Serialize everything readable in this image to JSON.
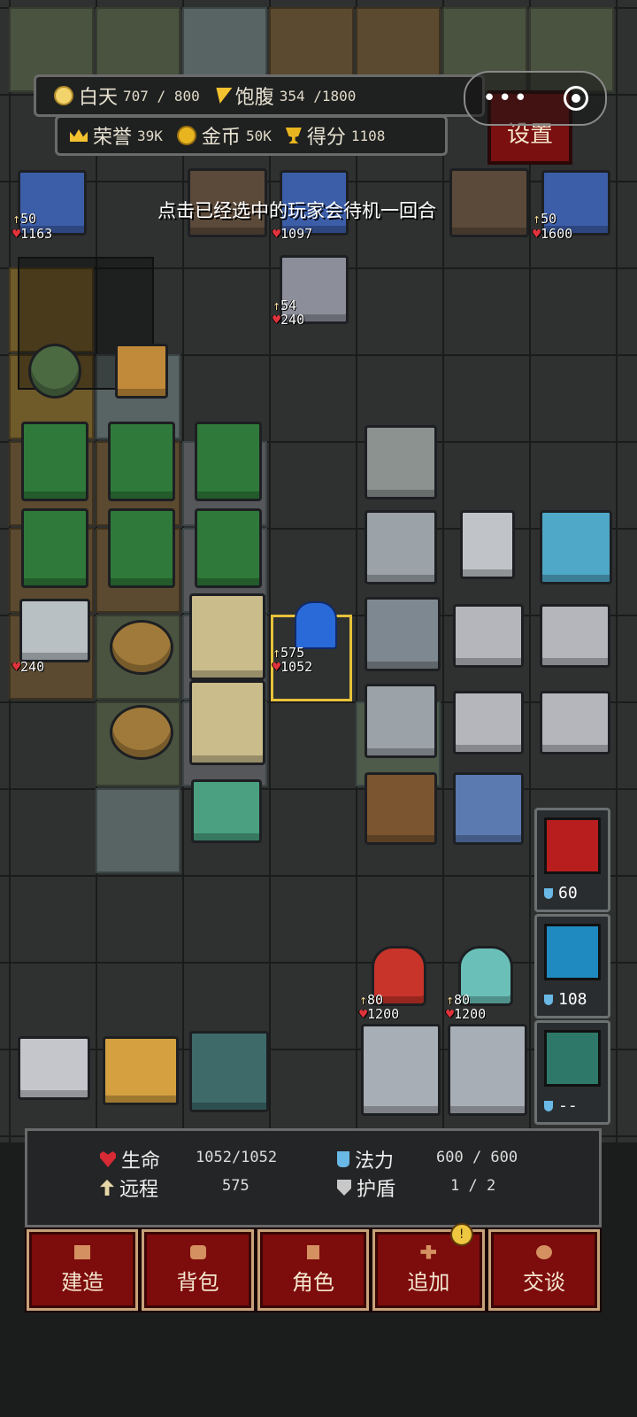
{
  "hud": {
    "day_label": "白天",
    "day_value": "707 / 800",
    "food_label": "饱腹",
    "food_value": "354 /1800",
    "honor_label": "荣誉",
    "honor_value": "39K",
    "gold_label": "金币",
    "gold_value": "50K",
    "score_label": "得分",
    "score_value": "1108"
  },
  "capsule": {
    "more": "•••"
  },
  "settings_label": "设置",
  "tip": "点击已经选中的玩家会待机一回合",
  "units": {
    "tower_1": {
      "atk": "50",
      "hp": "1163"
    },
    "tower_2": {
      "hp": "1097"
    },
    "tower_3": {
      "atk": "50",
      "hp": "1600"
    },
    "knight": {
      "atk": "54",
      "hp": "240"
    },
    "workshop": {
      "hp": "240"
    },
    "player": {
      "atk": "575",
      "hp": "1052"
    },
    "girl_red": {
      "atk": "80",
      "hp": "1200"
    },
    "girl_teal": {
      "atk": "80",
      "hp": "1200"
    }
  },
  "skills": [
    {
      "name": "sword-skill",
      "cost": "60",
      "color": "#d83030"
    },
    {
      "name": "lightning-skill",
      "cost": "108",
      "color": "#3bb0e0"
    },
    {
      "name": "shield-skill",
      "cost": "--",
      "color": "#40a890"
    }
  ],
  "player_panel": {
    "hp_label": "生命",
    "hp_value": "1052/1052",
    "mana_label": "法力",
    "mana_value": "600 / 600",
    "range_label": "远程",
    "range_value": "575",
    "shield_label": "护盾",
    "shield_value": "1  /  2"
  },
  "menu": {
    "build": "建造",
    "bag": "背包",
    "character": "角色",
    "add": "追加",
    "add_badge": "!",
    "talk": "交谈"
  }
}
